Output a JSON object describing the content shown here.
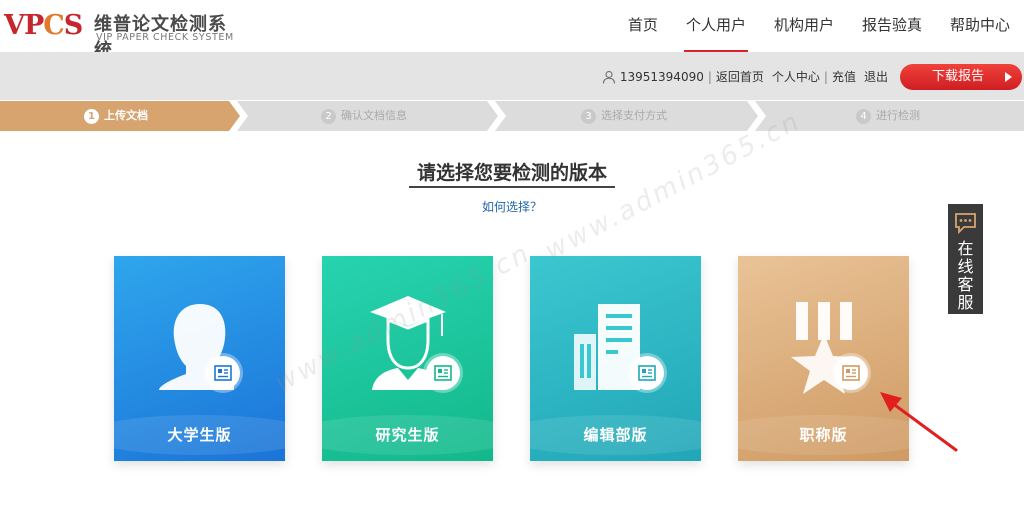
{
  "header": {
    "logo_mark": "VPCS",
    "logo_cn": "维普论文检测系统",
    "logo_en": "VIP PAPER CHECK SYSTEM",
    "nav": [
      {
        "label": "首页",
        "active": false
      },
      {
        "label": "个人用户",
        "active": true
      },
      {
        "label": "机构用户",
        "active": false
      },
      {
        "label": "报告验真",
        "active": false
      },
      {
        "label": "帮助中心",
        "active": false
      }
    ]
  },
  "userbar": {
    "phone": "13951394090",
    "back_home": "返回首页",
    "personal_center": "个人中心",
    "recharge": "充值",
    "logout": "退出",
    "download_report": "下载报告"
  },
  "steps": [
    {
      "num": "1",
      "label": "上传文档",
      "active": true
    },
    {
      "num": "2",
      "label": "确认文档信息",
      "active": false
    },
    {
      "num": "3",
      "label": "选择支付方式",
      "active": false
    },
    {
      "num": "4",
      "label": "进行检测",
      "active": false
    }
  ],
  "main": {
    "title": "请选择您要检测的版本",
    "how_to_choose": "如何选择？"
  },
  "cards": [
    {
      "label": "大学生版",
      "icon": "student-bust-icon",
      "color": "#1b74d8"
    },
    {
      "label": "研究生版",
      "icon": "graduate-cap-icon",
      "color": "#13b88a"
    },
    {
      "label": "编辑部版",
      "icon": "building-icon",
      "color": "#21a6b7"
    },
    {
      "label": "职称版",
      "icon": "medal-star-icon",
      "color": "#cf9a63"
    }
  ],
  "service": {
    "label": "在线客服",
    "chars": [
      "在",
      "线",
      "客",
      "服"
    ]
  },
  "watermark": {
    "text": "www.admin365.cn"
  },
  "colors": {
    "accent_red": "#d9232a",
    "step_active": "#d7a470",
    "step_inactive": "#dcdcdc"
  }
}
